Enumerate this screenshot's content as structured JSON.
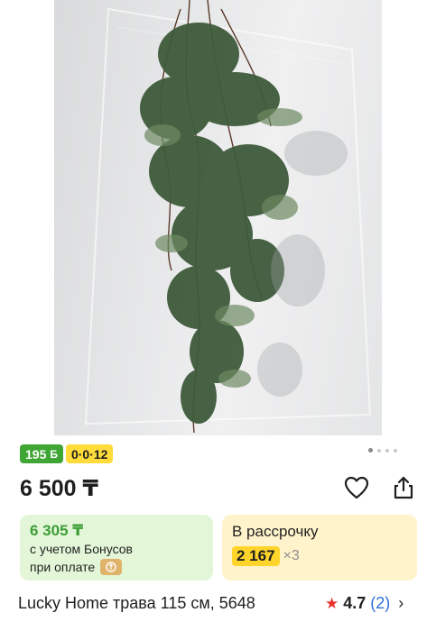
{
  "product": {
    "image_alt": "artificial hanging fern plant",
    "title": "Lucky Home трава 115 см, 5648",
    "price": "6 500 ₸",
    "rating": "4.7",
    "reviews_count": "(2)"
  },
  "badges": {
    "bonus_amount": "195",
    "bonus_icon_glyph": "Б",
    "installment_code": "0·0·12"
  },
  "carousel": {
    "dots_count": 4,
    "active_index": 0
  },
  "bonus_card": {
    "price": "6 305 ₸",
    "line1": "с учетом Бонусов",
    "line2": "при оплате"
  },
  "installment_card": {
    "label": "В рассрочку",
    "amount": "2 167",
    "multiplier": "×3"
  },
  "icons": {
    "favorite": "heart-icon",
    "share": "share-icon",
    "rating": "star-icon",
    "more": "chevron-right-icon",
    "pay": "kaspi-pay-icon"
  },
  "colors": {
    "bonus_green": "#3fa535",
    "install_yellow": "#ffdc3a",
    "bonus_card_bg": "#e3f6d8",
    "installment_card_bg": "#fff3cc",
    "rating_star": "#e8302a",
    "link_blue": "#2e6fd8"
  }
}
